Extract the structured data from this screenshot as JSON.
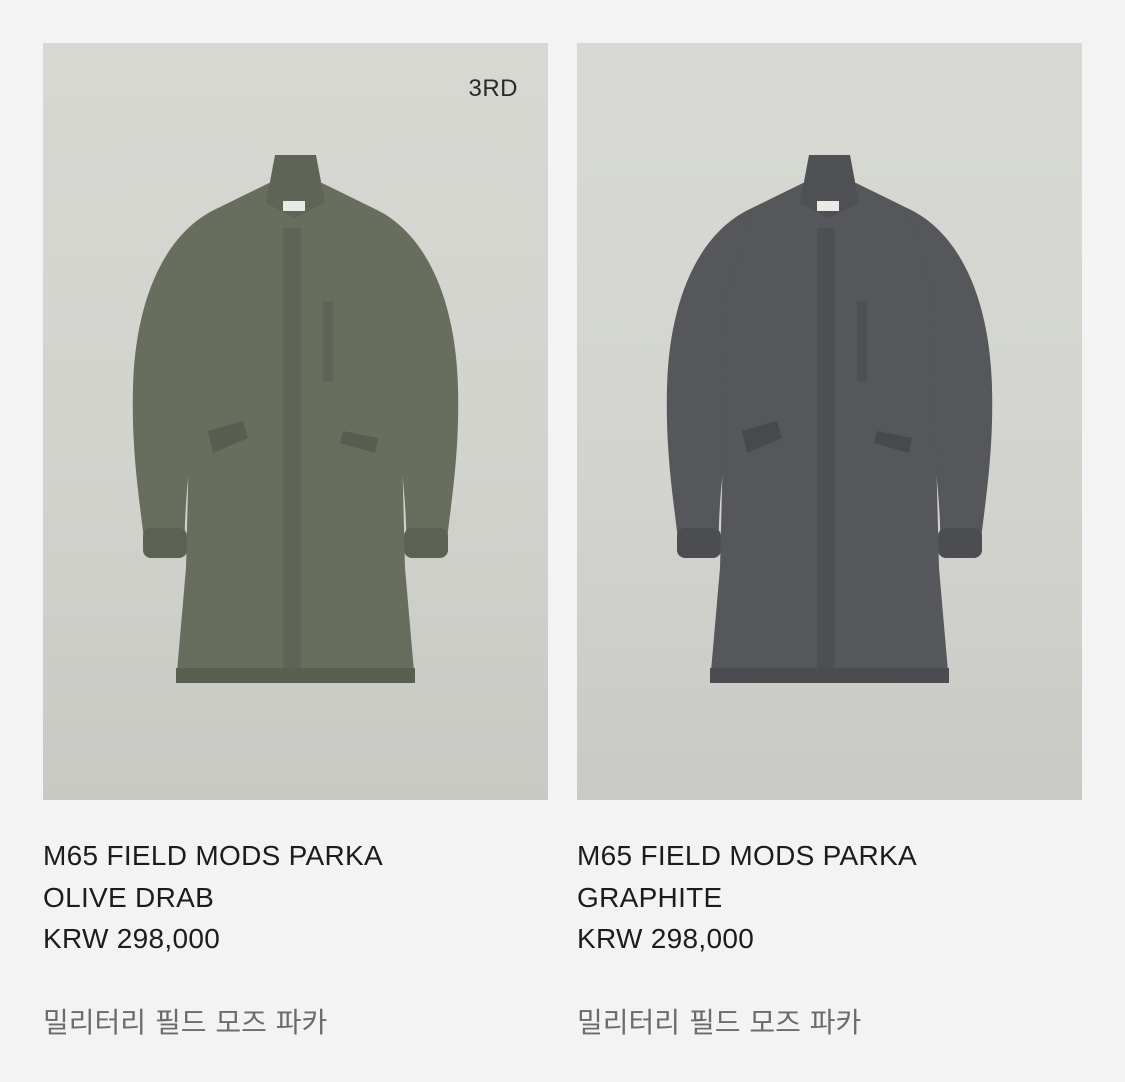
{
  "products": [
    {
      "badge": "3RD",
      "name_line1": "M65 FIELD MODS PARKA",
      "name_line2": "OLIVE DRAB",
      "price": "KRW 298,000",
      "subtitle": "밀리터리 필드 모즈 파카",
      "coat_color": "#676e5e",
      "coat_shadow": "#575d4f"
    },
    {
      "badge": "",
      "name_line1": "M65 FIELD MODS PARKA",
      "name_line2": "GRAPHITE",
      "price": "KRW 298,000",
      "subtitle": "밀리터리 필드 모즈 파카",
      "coat_color": "#55575a",
      "coat_shadow": "#47494c"
    }
  ]
}
